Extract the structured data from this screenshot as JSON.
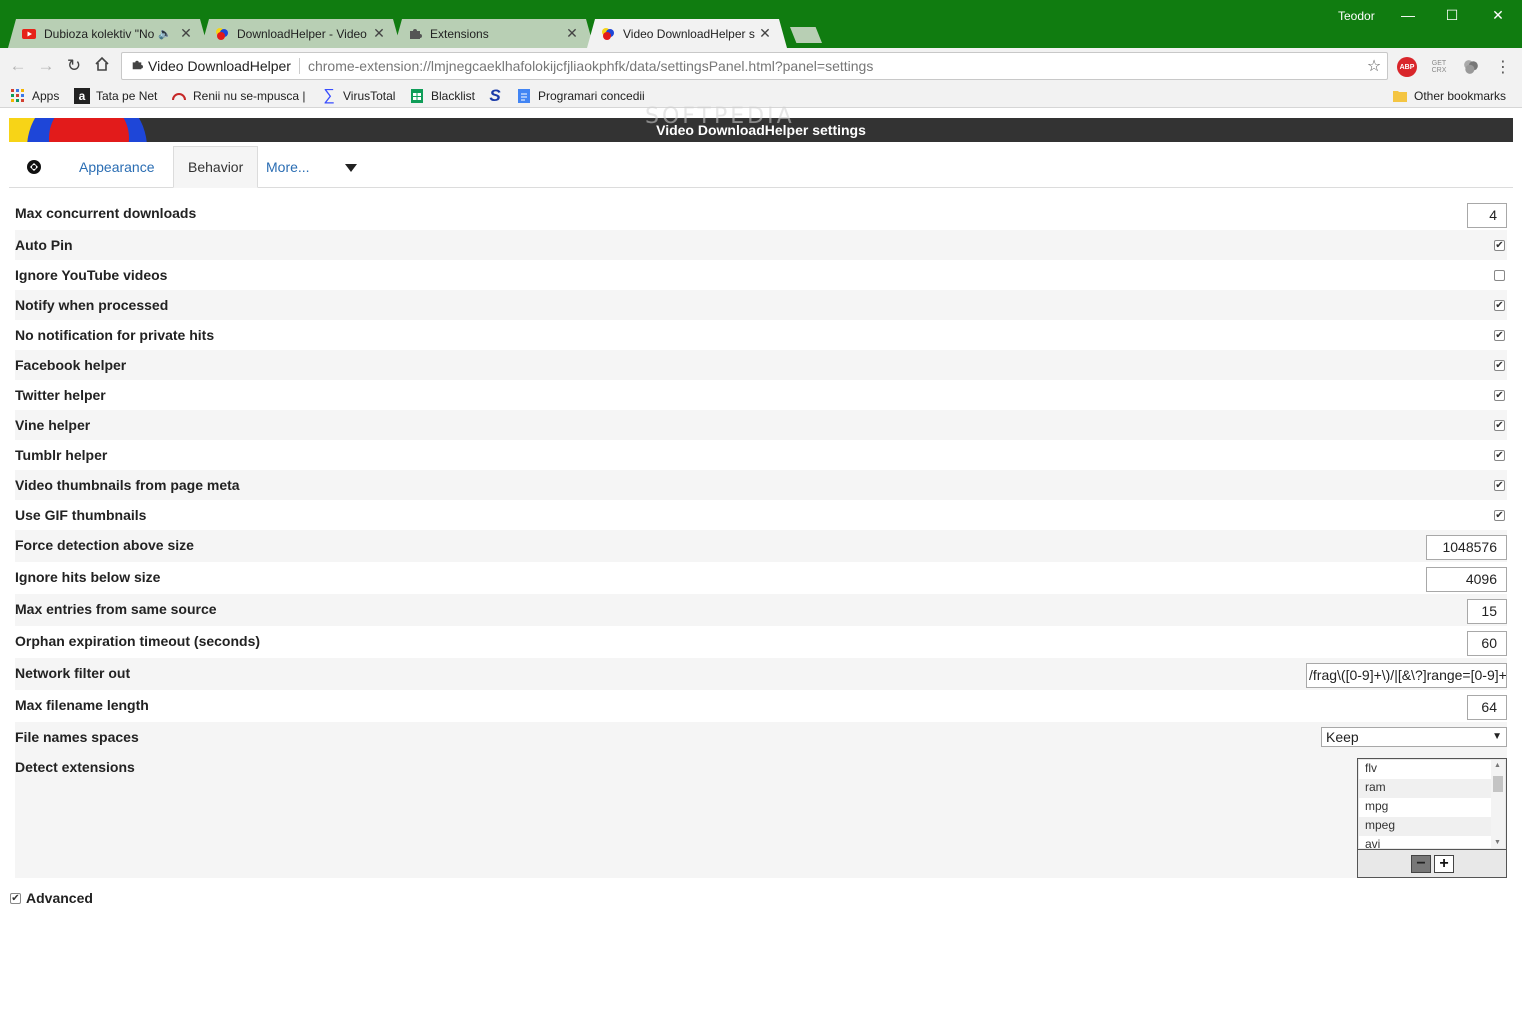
{
  "browser": {
    "tabs": [
      {
        "title": "Dubioza kolektiv \"No",
        "icon": "youtube-icon",
        "audio": true
      },
      {
        "title": "DownloadHelper - Video",
        "icon": "dh-icon"
      },
      {
        "title": "Extensions",
        "icon": "puzzle-icon"
      },
      {
        "title": "Video DownloadHelper s",
        "icon": "dh-icon"
      }
    ],
    "user": "Teodor",
    "origin_label": "Video DownloadHelper",
    "url": "chrome-extension://lmjnegcaeklhafolokijcfjliaokphfk/data/settingsPanel.html?panel=settings",
    "extensions": {
      "abp": "ABP",
      "getcrx": "GET CRX"
    },
    "bookmarks": [
      {
        "label": "Apps",
        "icon": "apps-grid-icon"
      },
      {
        "label": "Tata pe Net",
        "icon": "a-letter-icon"
      },
      {
        "label": "Renii nu se-mpusca |",
        "icon": "gauge-icon"
      },
      {
        "label": "VirusTotal",
        "icon": "sigma-icon"
      },
      {
        "label": "Blacklist",
        "icon": "sheet-icon"
      },
      {
        "label": "",
        "icon": "s-logo-icon"
      },
      {
        "label": "Programari concedii",
        "icon": "doc-icon"
      }
    ],
    "other_bookmarks": "Other bookmarks",
    "watermark": "SOFTPEDIA"
  },
  "page": {
    "title": "Video DownloadHelper settings",
    "tabs": [
      "Appearance",
      "Behavior",
      "More..."
    ],
    "settings": [
      {
        "label": "Max concurrent downloads",
        "type": "number",
        "value": "4"
      },
      {
        "label": "Auto Pin",
        "type": "checkbox",
        "checked": true
      },
      {
        "label": "Ignore YouTube videos",
        "type": "checkbox",
        "checked": false
      },
      {
        "label": "Notify when processed",
        "type": "checkbox",
        "checked": true
      },
      {
        "label": "No notification for private hits",
        "type": "checkbox",
        "checked": true
      },
      {
        "label": "Facebook helper",
        "type": "checkbox",
        "checked": true
      },
      {
        "label": "Twitter helper",
        "type": "checkbox",
        "checked": true
      },
      {
        "label": "Vine helper",
        "type": "checkbox",
        "checked": true
      },
      {
        "label": "Tumblr helper",
        "type": "checkbox",
        "checked": true
      },
      {
        "label": "Video thumbnails from page meta",
        "type": "checkbox",
        "checked": true
      },
      {
        "label": "Use GIF thumbnails",
        "type": "checkbox",
        "checked": true
      },
      {
        "label": "Force detection above size",
        "type": "number",
        "value": "1048576"
      },
      {
        "label": "Ignore hits below size",
        "type": "number",
        "value": "4096"
      },
      {
        "label": "Max entries from same source",
        "type": "number",
        "value": "15"
      },
      {
        "label": "Orphan expiration timeout (seconds)",
        "type": "number",
        "value": "60"
      },
      {
        "label": "Network filter out",
        "type": "text",
        "value": "/frag\\([0-9]+\\)/|[&\\?]range=[0-9]+"
      },
      {
        "label": "Max filename length",
        "type": "number",
        "value": "64"
      },
      {
        "label": "File names spaces",
        "type": "select",
        "value": "Keep"
      },
      {
        "label": "Detect extensions",
        "type": "list",
        "items": [
          "flv",
          "ram",
          "mpg",
          "mpeg",
          "avi"
        ]
      }
    ],
    "advanced": {
      "label": "Advanced",
      "checked": true
    }
  }
}
